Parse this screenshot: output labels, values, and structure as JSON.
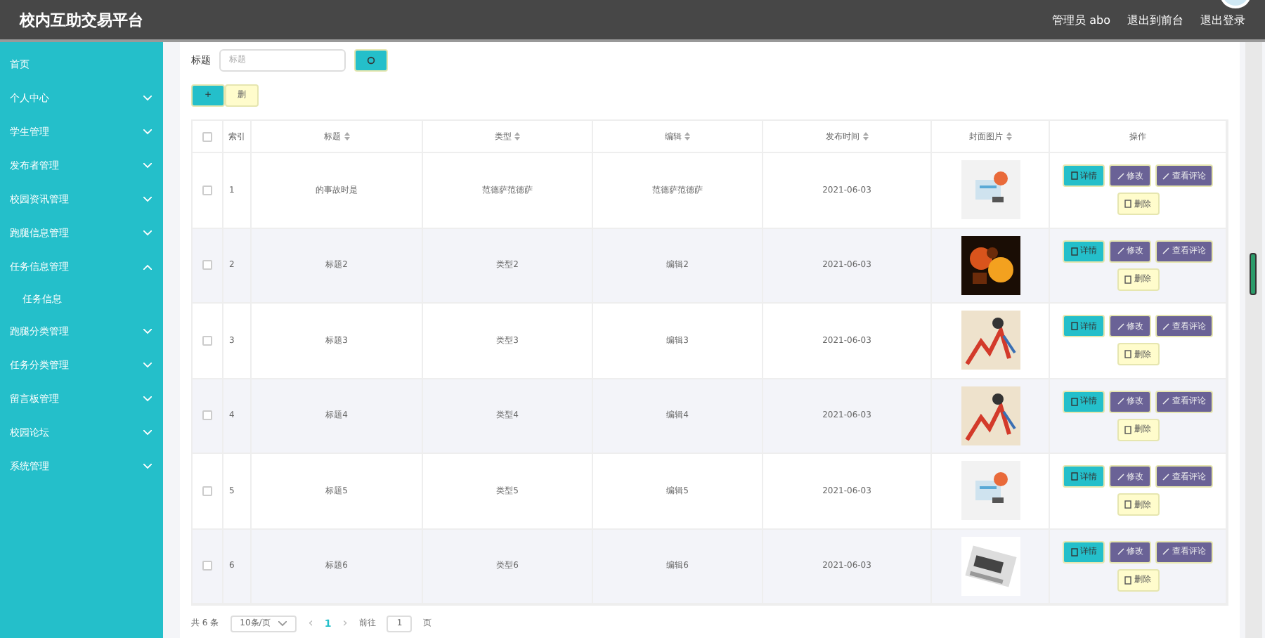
{
  "header": {
    "title": "校内互助交易平台",
    "user": "管理员 abo",
    "links": [
      "退出到前台",
      "退出登录"
    ]
  },
  "sidebar": {
    "items": [
      {
        "label": "首页"
      },
      {
        "label": "个人中心",
        "expanded": false
      },
      {
        "label": "学生管理",
        "expanded": false
      },
      {
        "label": "发布者管理",
        "expanded": false
      },
      {
        "label": "校园资讯管理",
        "expanded": false
      },
      {
        "label": "跑腿信息管理",
        "expanded": false
      },
      {
        "label": "任务信息管理",
        "expanded": true,
        "children": [
          {
            "label": "任务信息"
          }
        ]
      },
      {
        "label": "跑腿分类管理",
        "expanded": false
      },
      {
        "label": "任务分类管理",
        "expanded": false
      },
      {
        "label": "留言板管理",
        "expanded": false
      },
      {
        "label": "校园论坛",
        "expanded": false
      },
      {
        "label": "系统管理",
        "expanded": false
      }
    ]
  },
  "search": {
    "label": "标题",
    "placeholder": "标题"
  },
  "toolbar": {
    "add": "+",
    "delete": "删"
  },
  "table": {
    "header_checked": false,
    "columns": [
      {
        "label": "索引",
        "sortable": false
      },
      {
        "label": "标题",
        "sortable": true
      },
      {
        "label": "类型",
        "sortable": true
      },
      {
        "label": "编辑",
        "sortable": true
      },
      {
        "label": "发布时间",
        "sortable": true
      },
      {
        "label": "封面图片",
        "sortable": true
      },
      {
        "label": "操作",
        "sortable": false
      }
    ],
    "rows": [
      {
        "checked": false,
        "index": "1",
        "title": "的事故时是",
        "type": "范德萨范德萨",
        "editor": "范德萨范德萨",
        "date": "2021-06-03",
        "actions": [
          "详情",
          "修改",
          "查看评论",
          "删除"
        ]
      },
      {
        "checked": false,
        "index": "2",
        "title": "标题2",
        "type": "类型2",
        "editor": "编辑2",
        "date": "2021-06-03",
        "actions": [
          "详情",
          "修改",
          "查看评论",
          "删除"
        ]
      },
      {
        "checked": false,
        "index": "3",
        "title": "标题3",
        "type": "类型3",
        "editor": "编辑3",
        "date": "2021-06-03",
        "actions": [
          "详情",
          "修改",
          "查看评论",
          "删除"
        ]
      },
      {
        "checked": false,
        "index": "4",
        "title": "标题4",
        "type": "类型4",
        "editor": "编辑4",
        "date": "2021-06-03",
        "actions": [
          "详情",
          "修改",
          "查看评论",
          "删除"
        ]
      },
      {
        "checked": false,
        "index": "5",
        "title": "标题5",
        "type": "类型5",
        "editor": "编辑5",
        "date": "2021-06-03",
        "actions": [
          "详情",
          "修改",
          "查看评论",
          "删除"
        ]
      },
      {
        "checked": false,
        "index": "6",
        "title": "标题6",
        "type": "类型6",
        "editor": "编辑6",
        "date": "2021-06-03",
        "actions": [
          "详情",
          "修改",
          "查看评论",
          "删除"
        ]
      }
    ]
  },
  "pagination": {
    "total": "共 6 条",
    "page_size": "10条/页",
    "prev": "‹",
    "pages": [
      {
        "label": "1",
        "selected": true
      }
    ],
    "next": "›",
    "goto_label": "前往",
    "goto_value": "1",
    "goto_suffix": "页"
  }
}
